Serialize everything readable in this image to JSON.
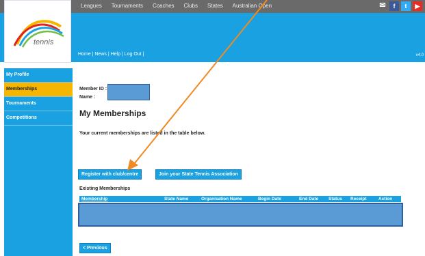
{
  "topnav": {
    "links": [
      "Leagues",
      "Tournaments",
      "Coaches",
      "Clubs",
      "States",
      "Australian Open"
    ]
  },
  "logo": {
    "text": "tennis"
  },
  "subnav": {
    "text": "Home | News | Help | Log Out |"
  },
  "version": "v4.0",
  "sidebar": {
    "items": [
      "My Profile",
      "Memberships",
      "Tournaments",
      "Competitions"
    ]
  },
  "member": {
    "id_label": "Member ID :",
    "name_label": "Name :"
  },
  "page_title": "My Memberships",
  "description": "Your current memberships are listed in the table below.",
  "buttons": {
    "register": "Register with club/centre",
    "join": "Join your State Tennis Association",
    "previous": "< Previous"
  },
  "existing_title": "Existing Memberships",
  "table": {
    "headers": [
      "Membership",
      "State Name",
      "Organisation Name",
      "Begin Date",
      "End Date",
      "Status",
      "Receipt",
      "Action"
    ]
  },
  "colors": {
    "accent": "#1aa1e1",
    "active": "#f5b500",
    "arrow": "#f08a24",
    "redaction": "#5b9bd5"
  }
}
